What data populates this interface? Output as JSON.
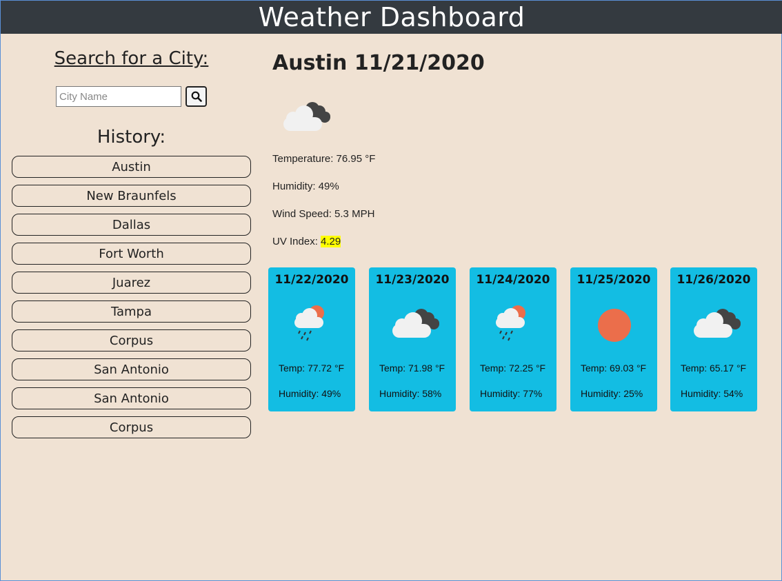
{
  "header": {
    "title": "Weather Dashboard"
  },
  "search": {
    "title": "Search for a City:",
    "placeholder": "City Name",
    "value": "",
    "button_icon": "search-icon"
  },
  "history": {
    "title": "History:",
    "items": [
      {
        "label": "Austin"
      },
      {
        "label": "New Braunfels"
      },
      {
        "label": "Dallas"
      },
      {
        "label": "Fort Worth"
      },
      {
        "label": "Juarez"
      },
      {
        "label": "Tampa"
      },
      {
        "label": "Corpus"
      },
      {
        "label": "San Antonio"
      },
      {
        "label": "San Antonio"
      },
      {
        "label": "Corpus"
      }
    ]
  },
  "current": {
    "title": "Austin 11/21/2020",
    "icon": "broken-clouds-icon",
    "temperature": "Temperature: 76.95 °F",
    "humidity": "Humidity: 49%",
    "wind": "Wind Speed: 5.3 MPH",
    "uv_label": "UV Index: ",
    "uv_value": "4.29",
    "uv_color": "#ffff00"
  },
  "forecast": [
    {
      "date": "11/22/2020",
      "icon": "light-rain-icon",
      "temp": "Temp: 77.72 °F",
      "humidity": "Humidity: 49%"
    },
    {
      "date": "11/23/2020",
      "icon": "broken-clouds-icon",
      "temp": "Temp: 71.98 °F",
      "humidity": "Humidity: 58%"
    },
    {
      "date": "11/24/2020",
      "icon": "light-rain-icon",
      "temp": "Temp: 72.25 °F",
      "humidity": "Humidity: 77%"
    },
    {
      "date": "11/25/2020",
      "icon": "clear-sky-sun-icon",
      "temp": "Temp: 69.03 °F",
      "humidity": "Humidity: 25%"
    },
    {
      "date": "11/26/2020",
      "icon": "broken-clouds-icon",
      "temp": "Temp: 65.17 °F",
      "humidity": "Humidity: 54%"
    }
  ],
  "colors": {
    "header_bg": "#343a40",
    "page_bg": "#f0e2d3",
    "card_bg": "#13bde3",
    "sun": "#eb6e4b"
  }
}
